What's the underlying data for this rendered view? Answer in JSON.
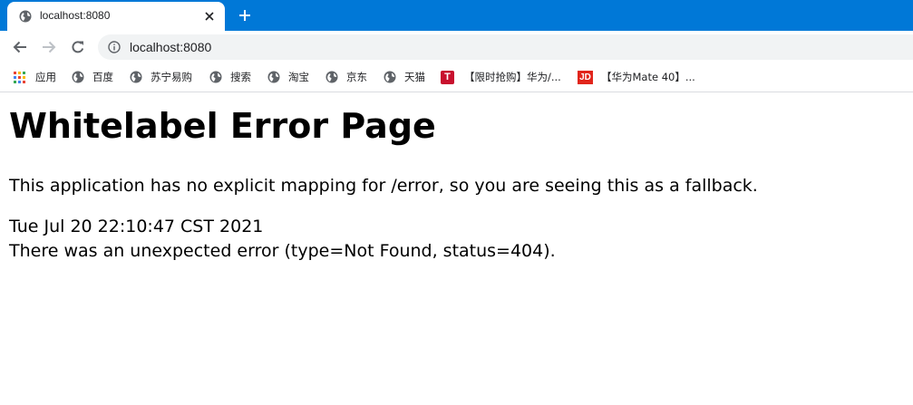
{
  "browser": {
    "tab": {
      "title": "localhost:8080",
      "icon": "globe-icon"
    },
    "new_tab_icon": "plus-icon",
    "close_icon": "close-icon",
    "address_bar": {
      "url": "localhost:8080",
      "icon": "info-icon"
    },
    "colors": {
      "tabstrip": "#0078d7",
      "omnibox": "#f1f3f4"
    }
  },
  "bookmarks": {
    "items": [
      {
        "label": "应用",
        "icon": "apps-grid-icon"
      },
      {
        "label": "百度",
        "icon": "globe-icon"
      },
      {
        "label": "苏宁易购",
        "icon": "globe-icon"
      },
      {
        "label": "搜索",
        "icon": "globe-icon"
      },
      {
        "label": "淘宝",
        "icon": "globe-icon"
      },
      {
        "label": "京东",
        "icon": "globe-icon"
      },
      {
        "label": "天猫",
        "icon": "globe-icon"
      },
      {
        "label": "【限时抢购】华为/...",
        "icon": "tmall-t-icon",
        "icon_text": "T"
      },
      {
        "label": "【华为Mate 40】...",
        "icon": "jd-icon",
        "icon_text": "JD"
      }
    ]
  },
  "page": {
    "heading": "Whitelabel Error Page",
    "message": "This application has no explicit mapping for /error, so you are seeing this as a fallback.",
    "timestamp": "Tue Jul 20 22:10:47 CST 2021",
    "error": "There was an unexpected error (type=Not Found, status=404)."
  }
}
